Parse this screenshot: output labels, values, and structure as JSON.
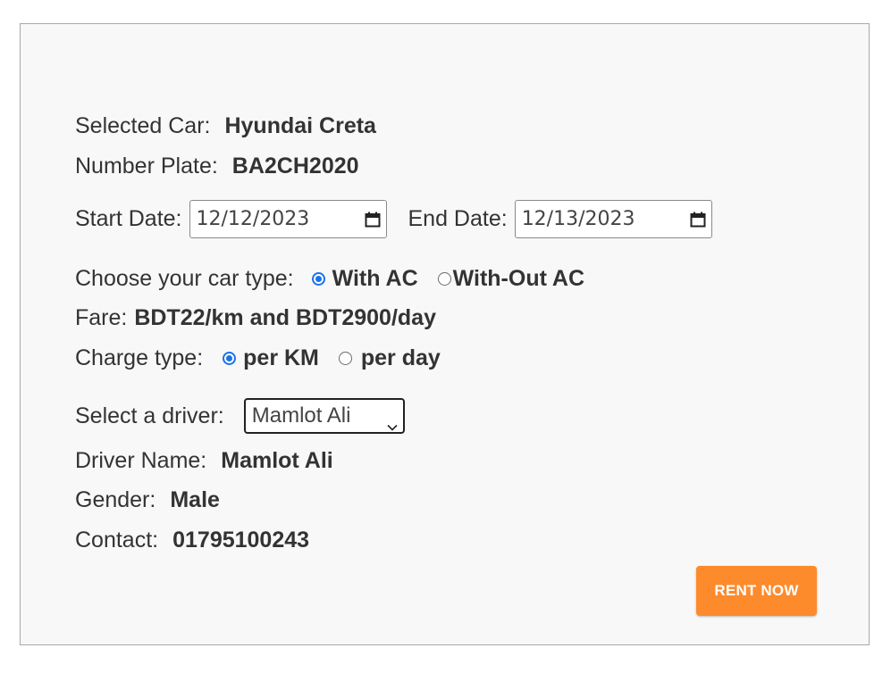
{
  "car": {
    "label": "Selected Car:",
    "value": "Hyundai Creta"
  },
  "plate": {
    "label": "Number Plate:",
    "value": "BA2CH2020"
  },
  "dates": {
    "start_label": "Start Date:",
    "start_value": "12/12/2023",
    "end_label": "End Date:",
    "end_value": "12/13/2023",
    "icon": "calendar-icon"
  },
  "car_type": {
    "label": "Choose your car type:",
    "options": [
      {
        "label": "With AC",
        "checked": true
      },
      {
        "label": "With-Out AC",
        "checked": false
      }
    ]
  },
  "fare": {
    "label": "Fare:",
    "value": "BDT22/km and BDT2900/day"
  },
  "charge_type": {
    "label": "Charge type:",
    "options": [
      {
        "label": "per KM",
        "checked": true
      },
      {
        "label": "per day",
        "checked": false
      }
    ]
  },
  "driver_select": {
    "label": "Select a driver:",
    "selected": "Mamlot Ali",
    "icon": "chevron-down-icon"
  },
  "driver": {
    "name_label": "Driver Name:",
    "name_value": "Mamlot Ali",
    "gender_label": "Gender:",
    "gender_value": "Male",
    "contact_label": "Contact:",
    "contact_value": "01795100243"
  },
  "rent_button": {
    "label": "RENT NOW"
  },
  "colors": {
    "accent": "#fd8b2c",
    "radio": "#1a73e8",
    "panel": "#f8f8f8"
  }
}
